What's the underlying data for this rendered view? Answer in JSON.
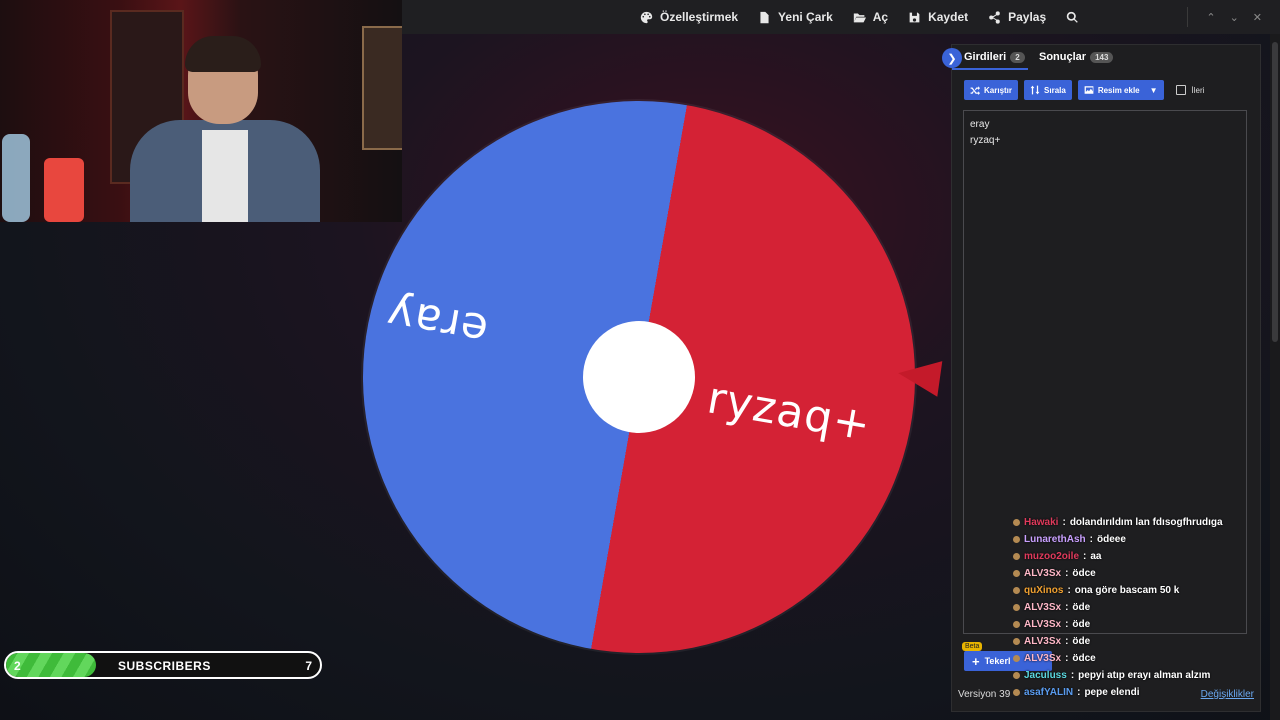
{
  "topbar": {
    "items": [
      {
        "label": "Özelleştirmek",
        "icon": "palette-icon"
      },
      {
        "label": "Yeni Çark",
        "icon": "file-icon"
      },
      {
        "label": "Aç",
        "icon": "folder-open-icon"
      },
      {
        "label": "Kaydet",
        "icon": "save-icon"
      },
      {
        "label": "Paylaş",
        "icon": "share-icon"
      }
    ],
    "search_icon": "search-icon",
    "window_controls": [
      "chevron-up-icon",
      "chevron-down-icon",
      "close-icon"
    ]
  },
  "wheel": {
    "segments": [
      {
        "label": "eray",
        "color": "#4a73df"
      },
      {
        "label": "ryzaq+",
        "color": "#d42235"
      }
    ],
    "pointer_color": "#c41a2a"
  },
  "panel": {
    "tabs": [
      {
        "label": "Girdileri",
        "count": "2"
      },
      {
        "label": "Sonuçlar",
        "count": "143"
      }
    ],
    "buttons": {
      "shuffle": "Karıştır",
      "sort": "Sırala",
      "add_image": "Resim ekle"
    },
    "advanced_label": "İleri",
    "entries_text": "eray\nryzaq+",
    "add_wheel_label": "Tekerl",
    "beta_label": "Beta",
    "version": "Versiyon 39",
    "changelog": "Değişiklikler",
    "accent": "#3a63d8"
  },
  "chat": [
    {
      "user": "Hawaki",
      "color": "#e03a5c",
      "msg": "dolandırıldım lan fdısogfhrudıga"
    },
    {
      "user": "LunarethAsh",
      "color": "#c9a0ff",
      "msg": "ödeee"
    },
    {
      "user": "muzoo2oile",
      "color": "#e03a5c",
      "msg": "aa"
    },
    {
      "user": "ALV3Sx",
      "color": "#ffb8c8",
      "msg": "ödce"
    },
    {
      "user": "quXinos",
      "color": "#f0a030",
      "msg": "ona göre bascam 50 k"
    },
    {
      "user": "ALV3Sx",
      "color": "#ffb8c8",
      "msg": "öde"
    },
    {
      "user": "ALV3Sx",
      "color": "#ffb8c8",
      "msg": "öde"
    },
    {
      "user": "ALV3Sx",
      "color": "#ffb8c8",
      "msg": "öde"
    },
    {
      "user": "ALV3Sx",
      "color": "#ffb8c8",
      "msg": "ödce"
    },
    {
      "user": "Jaculuss",
      "color": "#5ad8e0",
      "msg": "pepyi atıp erayı alman alzım"
    },
    {
      "user": "asafYALIN",
      "color": "#5a9cf0",
      "msg": "pepe elendi"
    }
  ],
  "subscribers": {
    "current": "2",
    "label": "SUBSCRIBERS",
    "goal": "7",
    "progress": 0.2857
  }
}
